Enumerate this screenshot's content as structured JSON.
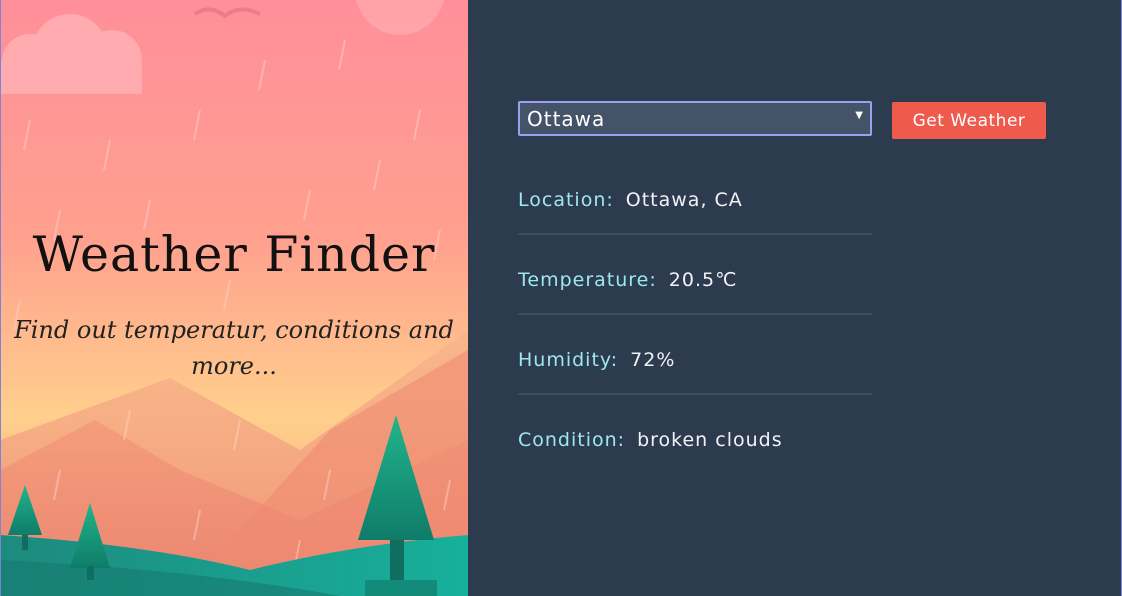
{
  "hero": {
    "title": "Weather Finder",
    "subtitle": "Find out temperatur, conditions and more..."
  },
  "form": {
    "selected_city": "Ottawa",
    "button_label": "Get Weather"
  },
  "results": {
    "location_label": "Location:",
    "location_value": "Ottawa, CA",
    "temperature_label": "Temperature:",
    "temperature_value": "20.5℃",
    "humidity_label": "Humidity:",
    "humidity_value": "72%",
    "condition_label": "Condition:",
    "condition_value": "broken clouds"
  },
  "colors": {
    "panel_bg": "#2d3b4f",
    "accent_label": "#9de8ef",
    "button_bg": "#ee5b4c",
    "select_border": "#9aa2f0"
  }
}
